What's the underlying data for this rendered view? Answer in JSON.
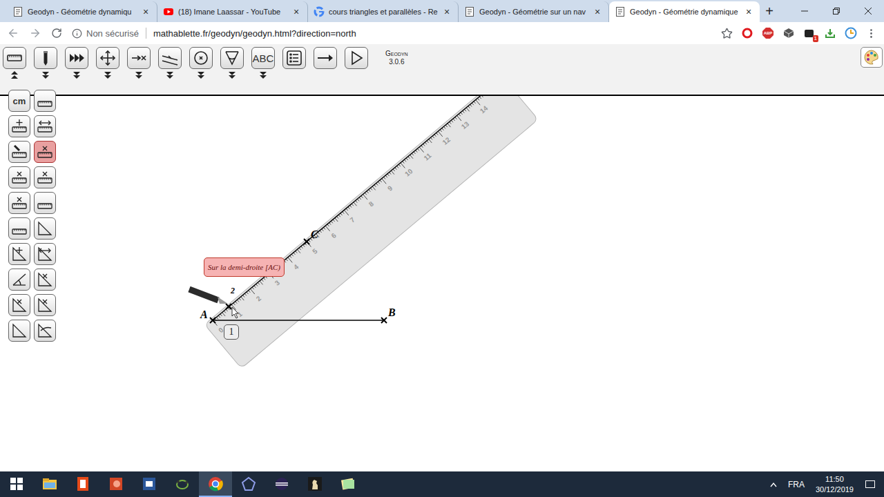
{
  "browser": {
    "tabs": [
      {
        "title": "Geodyn - Géométrie dynamiqu",
        "favicon": "page",
        "selected": false
      },
      {
        "title": "(18) Imane Laassar - YouTube",
        "favicon": "youtube",
        "selected": false
      },
      {
        "title": "cours triangles et parallèles - Re",
        "favicon": "google",
        "selected": false
      },
      {
        "title": "Geodyn - Géométrie sur un nav",
        "favicon": "page",
        "selected": false
      },
      {
        "title": "Geodyn - Géométrie dynamique",
        "favicon": "page",
        "selected": true
      }
    ],
    "close": "×",
    "new_tab": "+"
  },
  "address": {
    "security": "Non sécurisé",
    "url": "mathablette.fr/geodyn/geodyn.html?direction=north"
  },
  "extensions": [
    {
      "kind": "opera",
      "label": "",
      "badge": ""
    },
    {
      "kind": "adblock",
      "label": "ABP",
      "badge": ""
    },
    {
      "kind": "cube",
      "label": "",
      "badge": ""
    },
    {
      "kind": "puzzle",
      "label": "",
      "badge": "1"
    },
    {
      "kind": "download",
      "label": "",
      "badge": ""
    },
    {
      "kind": "clock",
      "label": "",
      "badge": ""
    }
  ],
  "app": {
    "name": "Geodyn",
    "version": "3.0.6",
    "tools": [
      {
        "kind": "ruler",
        "label": "",
        "has_menu": true,
        "expanded": true
      },
      {
        "kind": "pencil",
        "label": "",
        "has_menu": true,
        "expanded": false
      },
      {
        "kind": "forward",
        "label": "",
        "has_menu": true,
        "expanded": false
      },
      {
        "kind": "move",
        "label": "",
        "has_menu": true,
        "expanded": false
      },
      {
        "kind": "point",
        "label": "",
        "has_menu": true,
        "expanded": false
      },
      {
        "kind": "line",
        "label": "",
        "has_menu": true,
        "expanded": false
      },
      {
        "kind": "circle",
        "label": "",
        "has_menu": true,
        "expanded": false
      },
      {
        "kind": "angle",
        "label": "",
        "has_menu": true,
        "expanded": false
      },
      {
        "kind": "text",
        "label": "ABC",
        "has_menu": true,
        "expanded": false
      },
      {
        "kind": "list",
        "label": "",
        "has_menu": false,
        "expanded": false
      },
      {
        "kind": "arrow",
        "label": "",
        "has_menu": false,
        "expanded": false
      },
      {
        "kind": "play",
        "label": "",
        "has_menu": false,
        "expanded": false
      }
    ],
    "palette": [
      {
        "kind": "text",
        "label": "cm",
        "selected": false
      },
      {
        "kind": "ruler",
        "label": "",
        "selected": false
      },
      {
        "kind": "ruler-move",
        "label": "",
        "selected": false
      },
      {
        "kind": "ruler-resize",
        "label": "",
        "selected": false
      },
      {
        "kind": "ruler-pencil",
        "label": "",
        "selected": false
      },
      {
        "kind": "ruler-mark",
        "label": "",
        "selected": true
      },
      {
        "kind": "ruler-mark",
        "label": "",
        "selected": false
      },
      {
        "kind": "ruler-mark",
        "label": "",
        "selected": false
      },
      {
        "kind": "ruler-mark",
        "label": "",
        "selected": false
      },
      {
        "kind": "ruler",
        "label": "",
        "selected": false
      },
      {
        "kind": "ruler",
        "label": "",
        "selected": false
      },
      {
        "kind": "triangle",
        "label": "",
        "selected": false
      },
      {
        "kind": "triangle-move",
        "label": "",
        "selected": false
      },
      {
        "kind": "triangle-resize",
        "label": "",
        "selected": false
      },
      {
        "kind": "protractor",
        "label": "",
        "selected": false
      },
      {
        "kind": "triangle-mark",
        "label": "",
        "selected": false
      },
      {
        "kind": "triangle-mark",
        "label": "",
        "selected": false
      },
      {
        "kind": "triangle-mark",
        "label": "",
        "selected": false
      },
      {
        "kind": "triangle",
        "label": "",
        "selected": false
      },
      {
        "kind": "triangle-curve",
        "label": "",
        "selected": false
      }
    ]
  },
  "canvas": {
    "points": [
      {
        "label": "A"
      },
      {
        "label": "B"
      },
      {
        "label": "C"
      },
      {
        "label": "2"
      }
    ],
    "ruler": {
      "marks": [
        "0",
        "1",
        "2",
        "3",
        "4",
        "5",
        "6",
        "7",
        "8",
        "9",
        "10",
        "11",
        "12",
        "13",
        "14"
      ]
    },
    "tooltip": "Sur la demi-droite [AC)",
    "badge": "1"
  },
  "taskbar": {
    "apps": [
      {
        "kind": "explorer",
        "selected": false
      },
      {
        "kind": "office",
        "selected": false
      },
      {
        "kind": "powerpoint",
        "selected": false
      },
      {
        "kind": "word",
        "selected": false
      },
      {
        "kind": "geogebra",
        "selected": false
      },
      {
        "kind": "chrome",
        "selected": true
      },
      {
        "kind": "pentagon",
        "selected": false
      },
      {
        "kind": "eclipse",
        "selected": false
      },
      {
        "kind": "chess",
        "selected": false
      },
      {
        "kind": "notes",
        "selected": false
      }
    ],
    "language": "FRA",
    "time": "11:50",
    "date": "30/12/2019"
  }
}
